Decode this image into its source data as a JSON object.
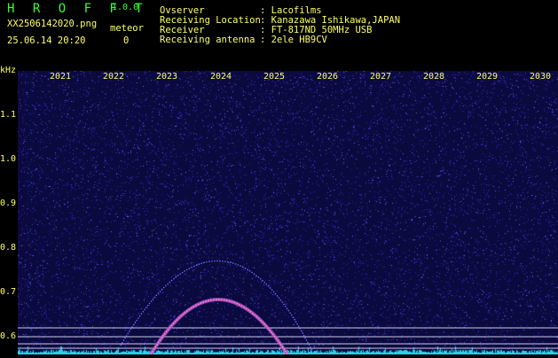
{
  "app": {
    "name": "H R O F F T",
    "version": "1.0.0"
  },
  "file": {
    "name": "XX2506142020.png",
    "datetime": "25.06.14 20:20"
  },
  "meteor": {
    "label": "meteor",
    "count": "0"
  },
  "station": {
    "observer_label": "Ovserver",
    "observer": ": Lacofilms",
    "location_label": "Receiving Location",
    "location": ": Kanazawa Ishikawa,JAPAN",
    "receiver_label": "Receiver",
    "receiver": ": FT-817ND 50MHz USB",
    "antenna_label": "Receiving antenna",
    "antenna": ": 2ele HB9CV"
  },
  "axes": {
    "y_unit": "kHz",
    "y_ticks": [
      "1.1",
      "1.0",
      "0.9",
      "0.8",
      "0.7",
      "0.6"
    ],
    "x_ticks": [
      "2021",
      "2022",
      "2023",
      "2024",
      "2025",
      "2026",
      "2027",
      "2028",
      "2029",
      "2030"
    ]
  },
  "colors": {
    "header_text": "#ffff66",
    "title": "#33ff33",
    "background": "#0b0a3e",
    "noise_floor": "#22d3ee"
  }
}
